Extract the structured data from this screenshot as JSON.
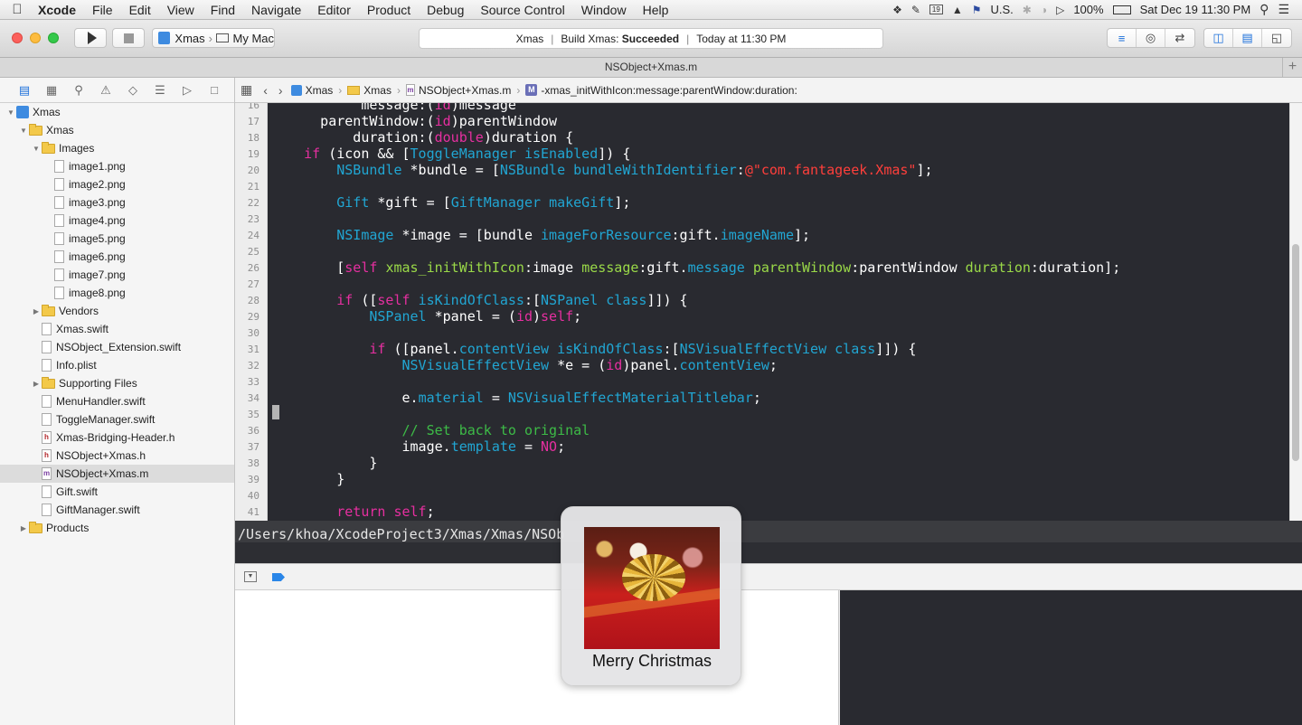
{
  "menubar": {
    "app_name": "Xcode",
    "items": [
      "File",
      "Edit",
      "View",
      "Find",
      "Navigate",
      "Editor",
      "Product",
      "Debug",
      "Source Control",
      "Window",
      "Help"
    ],
    "calendar_day": "19",
    "input_source": "U.S.",
    "battery": "100%",
    "clock": "Sat Dec 19  11:30 PM"
  },
  "toolbar": {
    "scheme": "Xmas",
    "destination": "My Mac",
    "status_project": "Xmas",
    "status_prefix": "Build Xmas:",
    "status_result": "Succeeded",
    "status_time": "Today at 11:30 PM"
  },
  "tab": {
    "title": "NSObject+Xmas.m"
  },
  "navigator": {
    "tree": [
      {
        "label": "Xmas",
        "kind": "project",
        "depth": 0,
        "open": true
      },
      {
        "label": "Xmas",
        "kind": "folder",
        "depth": 1,
        "open": true
      },
      {
        "label": "Images",
        "kind": "folder",
        "depth": 2,
        "open": true
      },
      {
        "label": "image1.png",
        "kind": "png",
        "depth": 3
      },
      {
        "label": "image2.png",
        "kind": "png",
        "depth": 3
      },
      {
        "label": "image3.png",
        "kind": "png",
        "depth": 3
      },
      {
        "label": "image4.png",
        "kind": "png",
        "depth": 3
      },
      {
        "label": "image5.png",
        "kind": "png",
        "depth": 3
      },
      {
        "label": "image6.png",
        "kind": "png",
        "depth": 3
      },
      {
        "label": "image7.png",
        "kind": "png",
        "depth": 3
      },
      {
        "label": "image8.png",
        "kind": "png",
        "depth": 3
      },
      {
        "label": "Vendors",
        "kind": "folder",
        "depth": 2,
        "open": false
      },
      {
        "label": "Xmas.swift",
        "kind": "swift",
        "depth": 2
      },
      {
        "label": "NSObject_Extension.swift",
        "kind": "swift",
        "depth": 2
      },
      {
        "label": "Info.plist",
        "kind": "plist",
        "depth": 2
      },
      {
        "label": "Supporting Files",
        "kind": "folder",
        "depth": 2,
        "open": false
      },
      {
        "label": "MenuHandler.swift",
        "kind": "swift",
        "depth": 2
      },
      {
        "label": "ToggleManager.swift",
        "kind": "swift",
        "depth": 2
      },
      {
        "label": "Xmas-Bridging-Header.h",
        "kind": "h",
        "depth": 2
      },
      {
        "label": "NSObject+Xmas.h",
        "kind": "h",
        "depth": 2
      },
      {
        "label": "NSObject+Xmas.m",
        "kind": "m",
        "depth": 2,
        "selected": true
      },
      {
        "label": "Gift.swift",
        "kind": "swift",
        "depth": 2
      },
      {
        "label": "GiftManager.swift",
        "kind": "swift",
        "depth": 2
      },
      {
        "label": "Products",
        "kind": "folder",
        "depth": 1,
        "open": false
      }
    ]
  },
  "jumpbar": {
    "crumbs": [
      "Xmas",
      "Xmas",
      "NSObject+Xmas.m"
    ],
    "method": "-xmas_initWithIcon:message:parentWindow:duration:"
  },
  "editor": {
    "lines": [
      {
        "n": "16",
        "tokens": [
          [
            "",
            "           message:("
          ],
          [
            "kw",
            "id"
          ],
          [
            "",
            ")message"
          ]
        ]
      },
      {
        "n": "17",
        "tokens": [
          [
            "",
            "      parentWindow:("
          ],
          [
            "kw",
            "id"
          ],
          [
            "",
            ")parentWindow"
          ]
        ]
      },
      {
        "n": "18",
        "tokens": [
          [
            "",
            "          duration:("
          ],
          [
            "kw",
            "double"
          ],
          [
            "",
            ")duration {"
          ]
        ]
      },
      {
        "n": "19",
        "tokens": [
          [
            "kw",
            "    if"
          ],
          [
            "",
            " (icon && ["
          ],
          [
            "cls",
            "ToggleManager"
          ],
          [
            "",
            " "
          ],
          [
            "mth",
            "isEnabled"
          ],
          [
            "",
            "]) {"
          ]
        ]
      },
      {
        "n": "20",
        "tokens": [
          [
            "cls",
            "        NSBundle"
          ],
          [
            "",
            " *bundle = ["
          ],
          [
            "cls",
            "NSBundle"
          ],
          [
            "",
            " "
          ],
          [
            "mth",
            "bundleWithIdentifier"
          ],
          [
            "",
            ":"
          ],
          [
            "str",
            "@\"com.fantageek.Xmas\""
          ],
          [
            "",
            "];"
          ]
        ]
      },
      {
        "n": "21",
        "tokens": [
          [
            "",
            ""
          ]
        ]
      },
      {
        "n": "22",
        "tokens": [
          [
            "cls",
            "        Gift"
          ],
          [
            "",
            " *gift = ["
          ],
          [
            "cls",
            "GiftManager"
          ],
          [
            "",
            " "
          ],
          [
            "mth",
            "makeGift"
          ],
          [
            "",
            "];"
          ]
        ]
      },
      {
        "n": "23",
        "tokens": [
          [
            "",
            ""
          ]
        ]
      },
      {
        "n": "24",
        "tokens": [
          [
            "cls",
            "        NSImage"
          ],
          [
            "",
            " *image = [bundle "
          ],
          [
            "mth",
            "imageForResource"
          ],
          [
            "",
            ":gift."
          ],
          [
            "mth",
            "imageName"
          ],
          [
            "",
            "];"
          ]
        ]
      },
      {
        "n": "25",
        "tokens": [
          [
            "",
            ""
          ]
        ]
      },
      {
        "n": "26",
        "tokens": [
          [
            "",
            "        ["
          ],
          [
            "kw",
            "self"
          ],
          [
            "",
            " "
          ],
          [
            "sel",
            "xmas_initWithIcon"
          ],
          [
            "",
            ":image "
          ],
          [
            "sel",
            "message"
          ],
          [
            "",
            ":gift."
          ],
          [
            "mth",
            "message"
          ],
          [
            "",
            " "
          ],
          [
            "sel",
            "parentWindow"
          ],
          [
            "",
            ":parentWindow "
          ],
          [
            "sel",
            "duration"
          ],
          [
            "",
            ":duration];"
          ]
        ]
      },
      {
        "n": "27",
        "tokens": [
          [
            "",
            ""
          ]
        ]
      },
      {
        "n": "28",
        "tokens": [
          [
            "kw",
            "        if"
          ],
          [
            "",
            " (["
          ],
          [
            "kw",
            "self"
          ],
          [
            "",
            " "
          ],
          [
            "mth",
            "isKindOfClass"
          ],
          [
            "",
            ":["
          ],
          [
            "cls",
            "NSPanel"
          ],
          [
            "",
            " "
          ],
          [
            "mth",
            "class"
          ],
          [
            "",
            "]]) {"
          ]
        ]
      },
      {
        "n": "29",
        "tokens": [
          [
            "cls",
            "            NSPanel"
          ],
          [
            "",
            " *panel = ("
          ],
          [
            "kw",
            "id"
          ],
          [
            "",
            ")"
          ],
          [
            "kw",
            "self"
          ],
          [
            "",
            ";"
          ]
        ]
      },
      {
        "n": "30",
        "tokens": [
          [
            "",
            ""
          ]
        ]
      },
      {
        "n": "31",
        "tokens": [
          [
            "kw",
            "            if"
          ],
          [
            "",
            " ([panel."
          ],
          [
            "mth",
            "contentView"
          ],
          [
            "",
            " "
          ],
          [
            "mth",
            "isKindOfClass"
          ],
          [
            "",
            ":["
          ],
          [
            "cls",
            "NSVisualEffectView"
          ],
          [
            "",
            " "
          ],
          [
            "mth",
            "class"
          ],
          [
            "",
            "]]) {"
          ]
        ]
      },
      {
        "n": "32",
        "tokens": [
          [
            "cls",
            "                NSVisualEffectView"
          ],
          [
            "",
            " *e = ("
          ],
          [
            "kw",
            "id"
          ],
          [
            "",
            ")panel."
          ],
          [
            "mth",
            "contentView"
          ],
          [
            "",
            ";"
          ]
        ]
      },
      {
        "n": "33",
        "tokens": [
          [
            "",
            ""
          ]
        ]
      },
      {
        "n": "34",
        "tokens": [
          [
            "",
            "                e."
          ],
          [
            "mth",
            "material"
          ],
          [
            "",
            " = "
          ],
          [
            "cls",
            "NSVisualEffectMaterialTitlebar"
          ],
          [
            "",
            ";"
          ]
        ]
      },
      {
        "n": "35",
        "tokens": [
          [
            "",
            ""
          ]
        ]
      },
      {
        "n": "36",
        "tokens": [
          [
            "cmt",
            "                // Set back to original"
          ]
        ]
      },
      {
        "n": "37",
        "tokens": [
          [
            "",
            "                image."
          ],
          [
            "mth",
            "template"
          ],
          [
            "",
            " = "
          ],
          [
            "kw",
            "NO"
          ],
          [
            "",
            ";"
          ]
        ]
      },
      {
        "n": "38",
        "tokens": [
          [
            "",
            "            }"
          ]
        ]
      },
      {
        "n": "39",
        "tokens": [
          [
            "",
            "        }"
          ]
        ]
      },
      {
        "n": "40",
        "tokens": [
          [
            "",
            ""
          ]
        ]
      },
      {
        "n": "41",
        "tokens": [
          [
            "kw",
            "        return"
          ],
          [
            "",
            " "
          ],
          [
            "kw",
            "self"
          ],
          [
            "",
            ";"
          ]
        ]
      }
    ]
  },
  "pathbar": {
    "path": "/Users/khoa/XcodeProject3/Xmas/Xmas/NSOb"
  },
  "notification": {
    "message": "Merry Christmas"
  }
}
